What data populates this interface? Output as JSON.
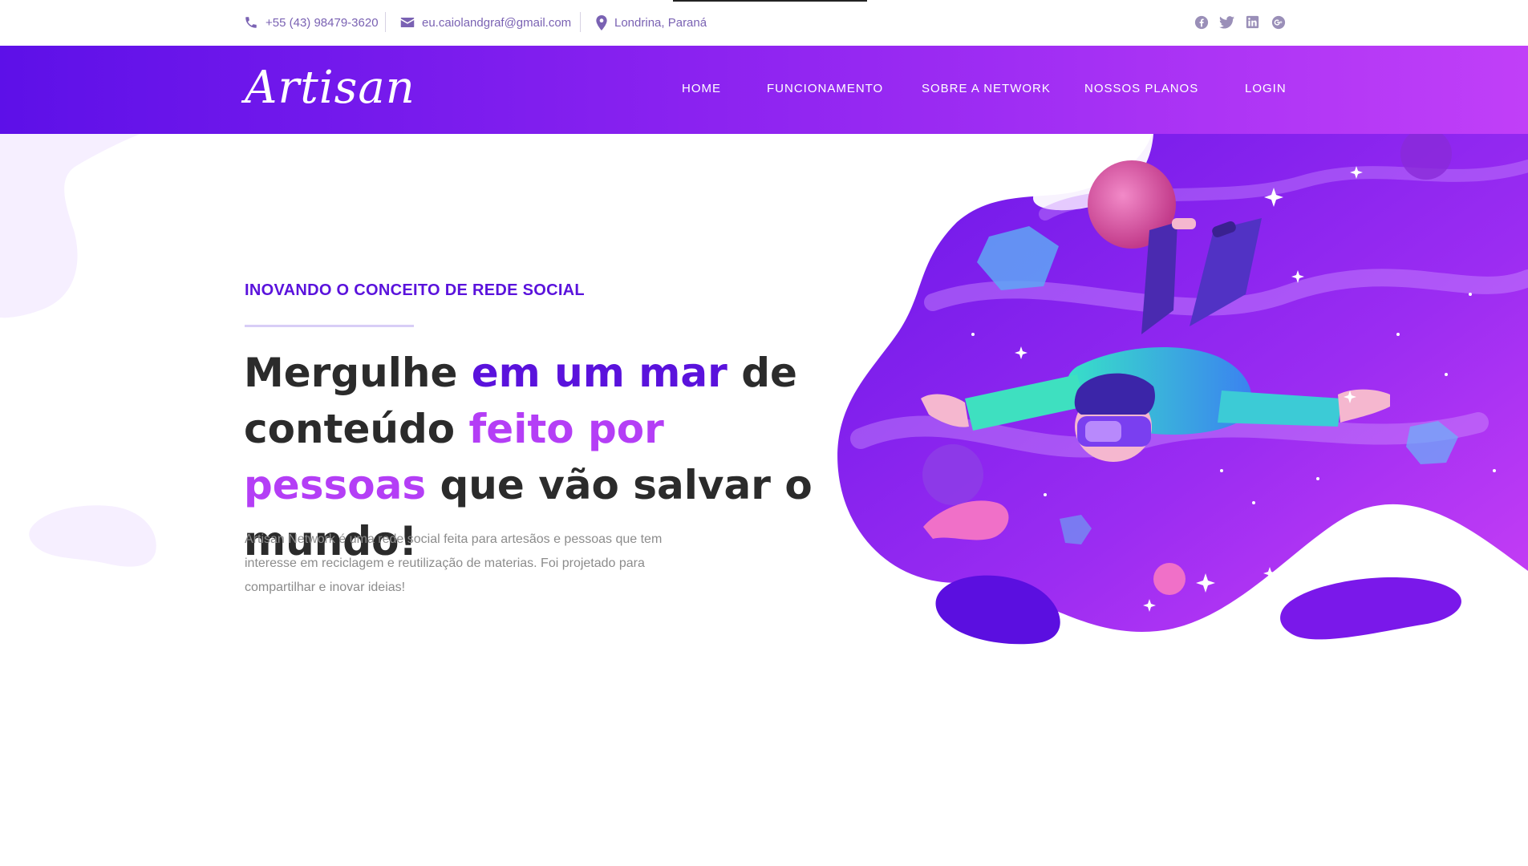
{
  "topbar": {
    "phone": "+55 (43) 98479-3620",
    "email": "eu.caiolandgraf@gmail.com",
    "location": "Londrina, Paraná",
    "social_icons": [
      "facebook-icon",
      "twitter-icon",
      "linkedin-icon",
      "google-plus-icon"
    ]
  },
  "navbar": {
    "logo": "Artisan",
    "items": [
      "HOME",
      "FUNCIONAMENTO",
      "SOBRE A NETWORK",
      "NOSSOS PLANOS",
      "LOGIN"
    ]
  },
  "hero": {
    "eyebrow": "INOVANDO O CONCEITO DE REDE SOCIAL",
    "headline": {
      "part1": "Mergulhe ",
      "part2": "em um mar",
      "part3": " de conteúdo  ",
      "part4": "feito por pessoas",
      "part5": " que vão salvar o mundo!"
    },
    "description": "Artisan Network é uma rede social feita para artesãos e pessoas que tem interesse em reciclagem e reutilização de materias. Foi projetado para compartilhar e inovar ideias!"
  },
  "colors": {
    "brand_purple": "#5a12dc",
    "accent_violet": "#b43ef6",
    "nav_gradient_start": "#5d10e8",
    "nav_gradient_end": "#c13ff8",
    "contact_text": "#7a62b3"
  }
}
